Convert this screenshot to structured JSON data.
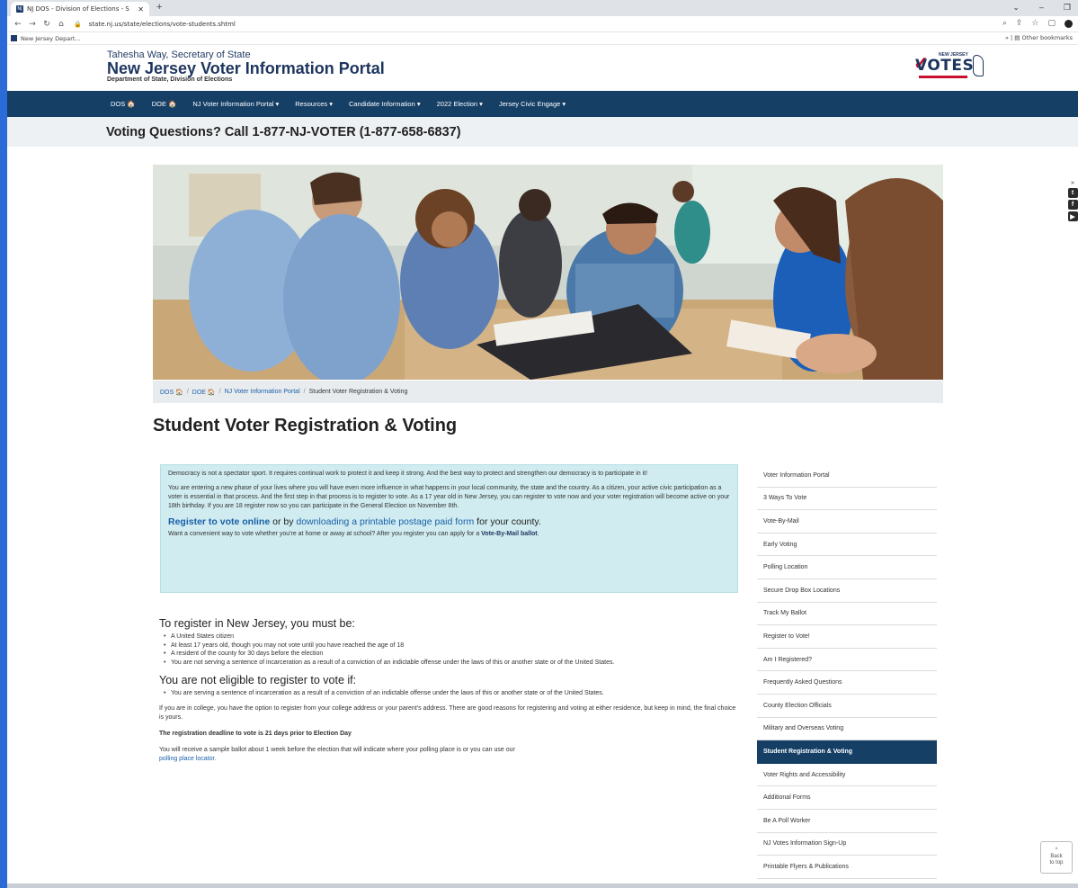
{
  "browser": {
    "tab_title": "NJ DOS - Division of Elections - S",
    "url": "state.nj.us/state/elections/vote-students.shtml",
    "bookmark": "New Jersey Depart...",
    "other_bookmarks": "Other bookmarks"
  },
  "header": {
    "secretary": "Tahesha Way, Secretary of State",
    "title": "New Jersey Voter Information Portal",
    "subtitle": "Department of State, Division of Elections",
    "logo_small": "NEW JERSEY",
    "logo_big": "VOTES"
  },
  "nav": {
    "items": [
      {
        "label": "DOS 🏠"
      },
      {
        "label": "DOE 🏠"
      },
      {
        "label": "NJ Voter Information Portal ▾"
      },
      {
        "label": "Resources ▾"
      },
      {
        "label": "Candidate Information ▾"
      },
      {
        "label": "2022 Election ▾"
      },
      {
        "label": "Jersey Civic Engage ▾"
      }
    ]
  },
  "callbar": {
    "text": "Voting Questions? Call 1-877-NJ-VOTER (1-877-658-6837)"
  },
  "breadcrumb": {
    "dos": "DOS 🏠",
    "doe": "DOE 🏠",
    "portal": "NJ Voter Information Portal",
    "current": "Student Voter Registration & Voting"
  },
  "page": {
    "title": "Student Voter Registration & Voting"
  },
  "intro": {
    "p1": "Democracy is not a spectator sport. It requires continual work to protect it and keep it strong. And the best way to protect and strengthen our democracy is to participate in it!",
    "p2": "You are entering a new phase of your lives where you will have even more influence in what happens in your local community, the state and the country. As a citizen, your active civic participation as a voter is essential in that process. And the first step in that process is to register to vote. As a 17 year old in New Jersey, you can register to vote now and your voter registration will become active on your 18th birthday. If you are 18 register now so you can participate in the General Election on November 8th.",
    "register_online": "Register to vote online",
    "or_by": " or by ",
    "download_link": "downloading a printable postage paid form",
    "for_county": " for your county.",
    "convenient": "Want a convenient way to vote whether you're at home or away at school? After you register you can apply for a ",
    "vbm_link": "Vote-By-Mail ballot",
    "period": "."
  },
  "content": {
    "must_be_heading": "To register in New Jersey, you must be:",
    "must_be": [
      "A United States citizen",
      "At least 17 years old, though you may not vote until you have reached the age of 18",
      "A resident of the county for 30 days before the election",
      "You are not serving a sentence of incarceration as a result of a conviction of an indictable offense under the laws of this or another state or of the United States."
    ],
    "not_eligible_heading": "You are not eligible to register to vote if:",
    "not_eligible": [
      "You are serving a sentence of incarceration as a result of a conviction of an indictable offense under the laws of this or another state or of the United States."
    ],
    "college": "If you are in college, you have the option to register from your college address or your parent's address. There are good reasons for registering and voting at either residence, but keep in mind, the final choice is yours.",
    "deadline": "The registration deadline to vote is 21 days prior to Election Day",
    "sample_ballot": "You will receive a sample ballot about 1 week before the election that will indicate where your polling place is or you can use our",
    "locator_link": "polling place locator."
  },
  "sidebar": {
    "items": [
      {
        "label": "Voter Information Portal"
      },
      {
        "label": "3 Ways To Vote"
      },
      {
        "label": "Vote-By-Mail"
      },
      {
        "label": "Early Voting"
      },
      {
        "label": "Polling Location"
      },
      {
        "label": "Secure Drop Box Locations"
      },
      {
        "label": "Track My Ballot"
      },
      {
        "label": "Register to Vote!"
      },
      {
        "label": "Am I Registered?"
      },
      {
        "label": "Frequently Asked Questions"
      },
      {
        "label": "County Election Officials"
      },
      {
        "label": "Military and Overseas Voting"
      },
      {
        "label": "Student Registration & Voting"
      },
      {
        "label": "Voter Rights and Accessibility"
      },
      {
        "label": "Additional Forms"
      },
      {
        "label": "Be A Poll Worker"
      },
      {
        "label": "NJ Votes Information Sign-Up"
      },
      {
        "label": "Printable Flyers & Publications"
      }
    ],
    "active_index": 12
  },
  "back_to_top": {
    "line1": "Back",
    "line2": "to top"
  },
  "colors": {
    "nav_bg": "#163f66",
    "link": "#1a5fa8",
    "intro_bg": "#d0ecf0"
  }
}
